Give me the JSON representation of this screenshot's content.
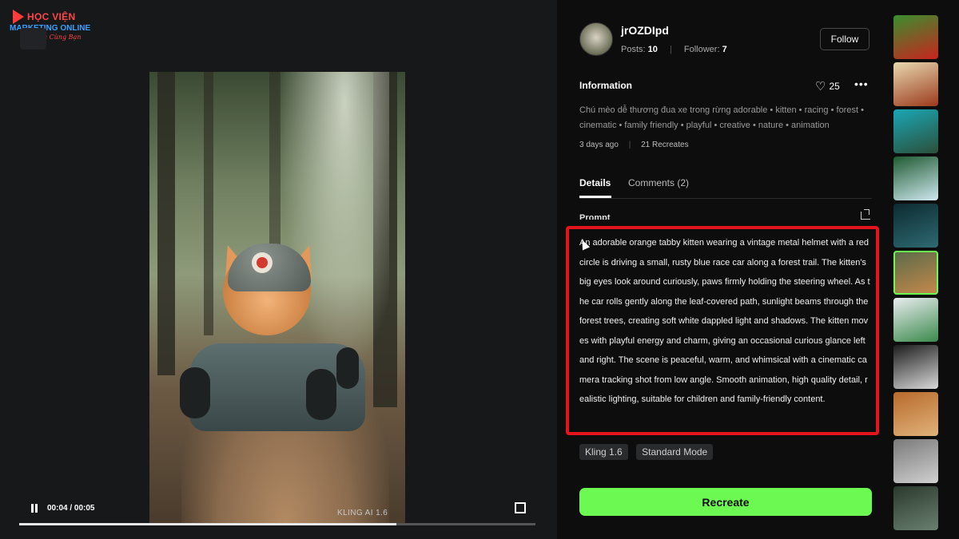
{
  "logo": {
    "line1": "HỌC VIỆN",
    "line2": "MARKETING ONLINE",
    "line3": "Vững và Cùng Bạn"
  },
  "video": {
    "watermark": "KLING AI 1.6",
    "time": "00:04 / 00:05",
    "progress": 0.73
  },
  "author": {
    "username": "jrOZDIpd",
    "posts_label": "Posts:",
    "posts_value": "10",
    "followers_label": "Follower:",
    "followers_value": "7",
    "follow_label": "Follow"
  },
  "info": {
    "title": "Information",
    "likes": "25",
    "description": "Chú mèo dễ thương đua xe trong rừng adorable • kitten • racing • forest • cinematic • family friendly • playful • creative • nature • animation",
    "age": "3 days ago",
    "recreates": "21 Recreates"
  },
  "tabs": [
    {
      "label": "Details",
      "active": true
    },
    {
      "label": "Comments (2)",
      "active": false
    }
  ],
  "prompt": {
    "label": "Prompt",
    "text": "An adorable orange tabby kitten wearing a vintage metal helmet with a red circle is driving a small, rusty blue race car along a forest trail. The kitten's big eyes look around curiously, paws firmly holding the steering wheel. As the car rolls gently along the leaf-covered path, sunlight beams through the forest trees, creating soft white dappled light and shadows. The kitten moves with playful energy and charm, giving an occasional curious glance left and right. The scene is peaceful, warm, and whimsical with a cinematic camera tracking shot from low angle. Smooth animation, high quality detail, realistic lighting, suitable for children and family-friendly content.",
    "highlight_color": "#e3141b"
  },
  "tags": [
    "Kling 1.6",
    "Standard Mode"
  ],
  "recreate_label": "Recreate",
  "accent": "#6cf952",
  "thumbnails": [
    {
      "name": "strawberry-thumbnail",
      "colors": [
        "#3a8f2e",
        "#c8241e"
      ]
    },
    {
      "name": "ship-thumbnail",
      "colors": [
        "#e8d8b0",
        "#9b3a1c"
      ]
    },
    {
      "name": "reef-thumbnail",
      "colors": [
        "#1aa7b5",
        "#2b4f3a"
      ]
    },
    {
      "name": "waterfall-thumbnail",
      "colors": [
        "#1f5a32",
        "#cfe8ef"
      ]
    },
    {
      "name": "cave-thumbnail",
      "colors": [
        "#0d2a30",
        "#2e6a72"
      ]
    },
    {
      "name": "kitten-thumbnail",
      "colors": [
        "#5c6b4a",
        "#c4884a"
      ],
      "active": true
    },
    {
      "name": "woman-thumbnail",
      "colors": [
        "#e9ecef",
        "#3b8a4c"
      ]
    },
    {
      "name": "cake-thumbnail",
      "colors": [
        "#1c1c1c",
        "#d9d9d9"
      ]
    },
    {
      "name": "puppy-thumbnail",
      "colors": [
        "#b86a2b",
        "#e0b27a"
      ]
    },
    {
      "name": "tunnel-thumbnail",
      "colors": [
        "#7a7a7a",
        "#d0d0d0"
      ]
    },
    {
      "name": "ruins-thumbnail",
      "colors": [
        "#2a3a2c",
        "#6a7f70"
      ]
    }
  ]
}
